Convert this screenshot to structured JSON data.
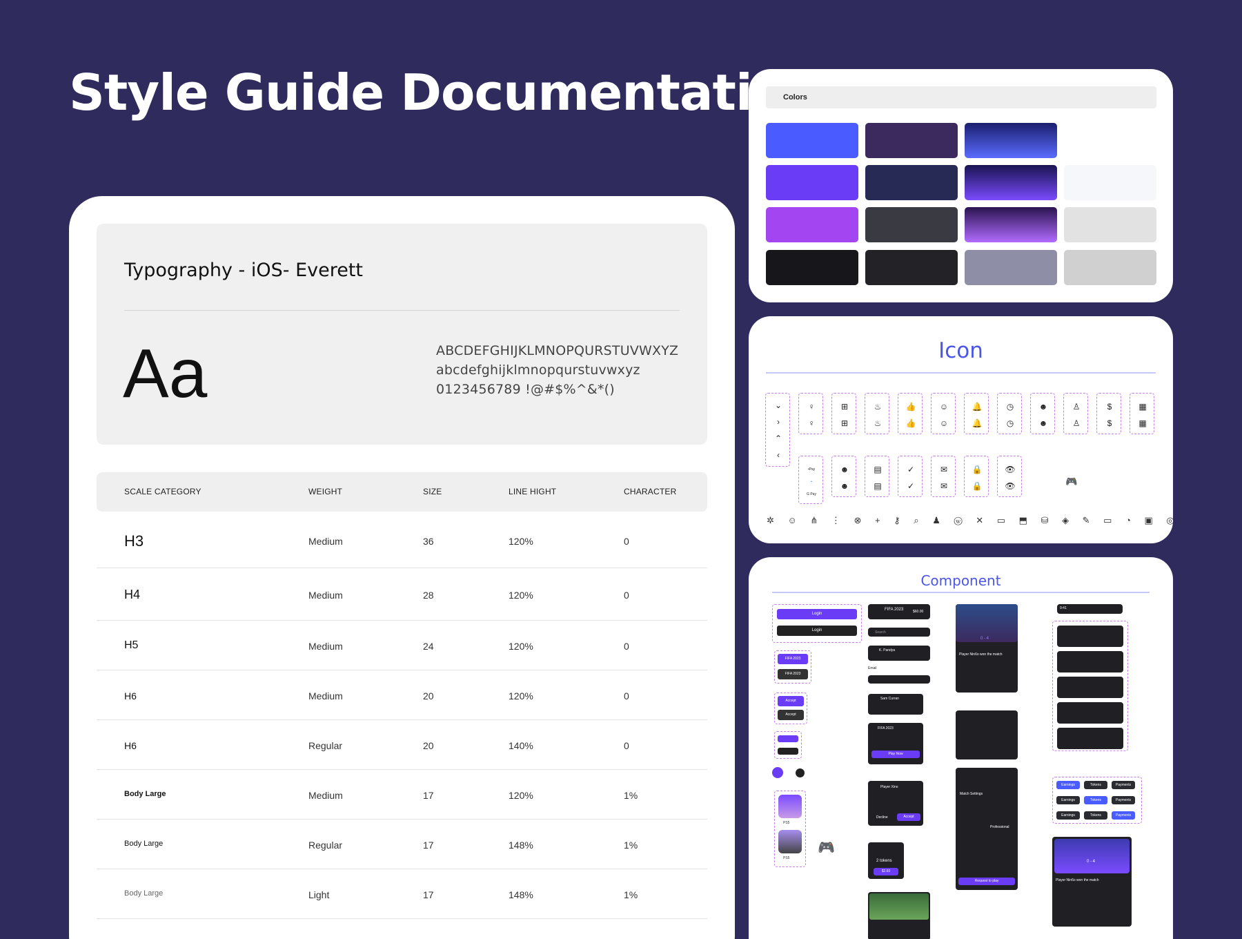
{
  "page": {
    "title": "Style Guide Documentation"
  },
  "typography": {
    "title": "Typography - iOS- Everett",
    "sample": "Aa",
    "charset": [
      "ABCDEFGHIJKLMNOPQURSTUVWXYZ",
      "abcdefghijklmnopqurstuvwxyz",
      "0123456789 !@#$%^&*()"
    ],
    "columns": [
      "SCALE CATEGORY",
      "WEIGHT",
      "SIZE",
      "LINE HIGHT",
      "CHARACTER"
    ],
    "rows": [
      [
        "H3",
        "Medium",
        "36",
        "120%",
        "0"
      ],
      [
        "H4",
        "Medium",
        "28",
        "120%",
        "0"
      ],
      [
        "H5",
        "Medium",
        "24",
        "120%",
        "0"
      ],
      [
        "H6",
        "Medium",
        "20",
        "120%",
        "0"
      ],
      [
        "H6",
        "Regular",
        "20",
        "140%",
        "0"
      ],
      [
        "Body Large",
        "Medium",
        "17",
        "120%",
        "1%"
      ],
      [
        "Body Large",
        "Regular",
        "17",
        "148%",
        "1%"
      ],
      [
        "Body Large",
        "Light",
        "17",
        "148%",
        "1%"
      ]
    ]
  },
  "colors": {
    "label": "Colors",
    "swatches": [
      "#4a5cff",
      "#3c2a5e",
      "linear-gradient(180deg,#1b1f6e,#5a6cff)",
      "#ffffff",
      "#6b3cf5",
      "#262a55",
      "linear-gradient(180deg,#1a1450,#7a4bff)",
      "#f6f7fb",
      "#a445f2",
      "#3a3a42",
      "linear-gradient(180deg,#2a1450,#b26bff)",
      "#e2e2e2",
      "#16161b",
      "#232327",
      "#8e8ea6",
      "#d0d0d0"
    ]
  },
  "icons": {
    "title": "Icon",
    "row_glyphs": [
      "⌄",
      "♀",
      "⊞",
      "♨",
      "👍",
      "☺",
      "🔔",
      "◷",
      "☻",
      "♙",
      "$",
      "▦"
    ],
    "row2_glyphs": [
      "☻",
      "▤",
      "✓",
      "✉",
      "🔒",
      "👁"
    ],
    "line": "✲ ☺ ⋔ ⋮ ⊗ + ⚷ ⌕ ♟ ⓦ ✕ ▭ ⬒ ⛁ ◈ ✎ ▭ ◔ ▣ ◎ ⚙ ⓘ"
  },
  "component": {
    "title": "Component",
    "login": "Login",
    "fifa": "FIFA 2023",
    "price": "$60.00",
    "search": "Search",
    "player1": "K. Pandya",
    "email": "Email",
    "sam": "Sam Curran",
    "playnow": "Play Now",
    "playerxino": "Player Xino",
    "decline": "Decline",
    "accept": "Accept",
    "score": "0 - 4",
    "won": "Player Nin6o won the match",
    "tokens": "2 tokens",
    "cost": "$2.60",
    "earnings": "Earnings",
    "tokens_label": "Tokens",
    "payments": "Payments",
    "request": "Request to play",
    "professional": "Professional",
    "match": "Match Settings",
    "ps5": "PS5",
    "time": "9:41"
  }
}
